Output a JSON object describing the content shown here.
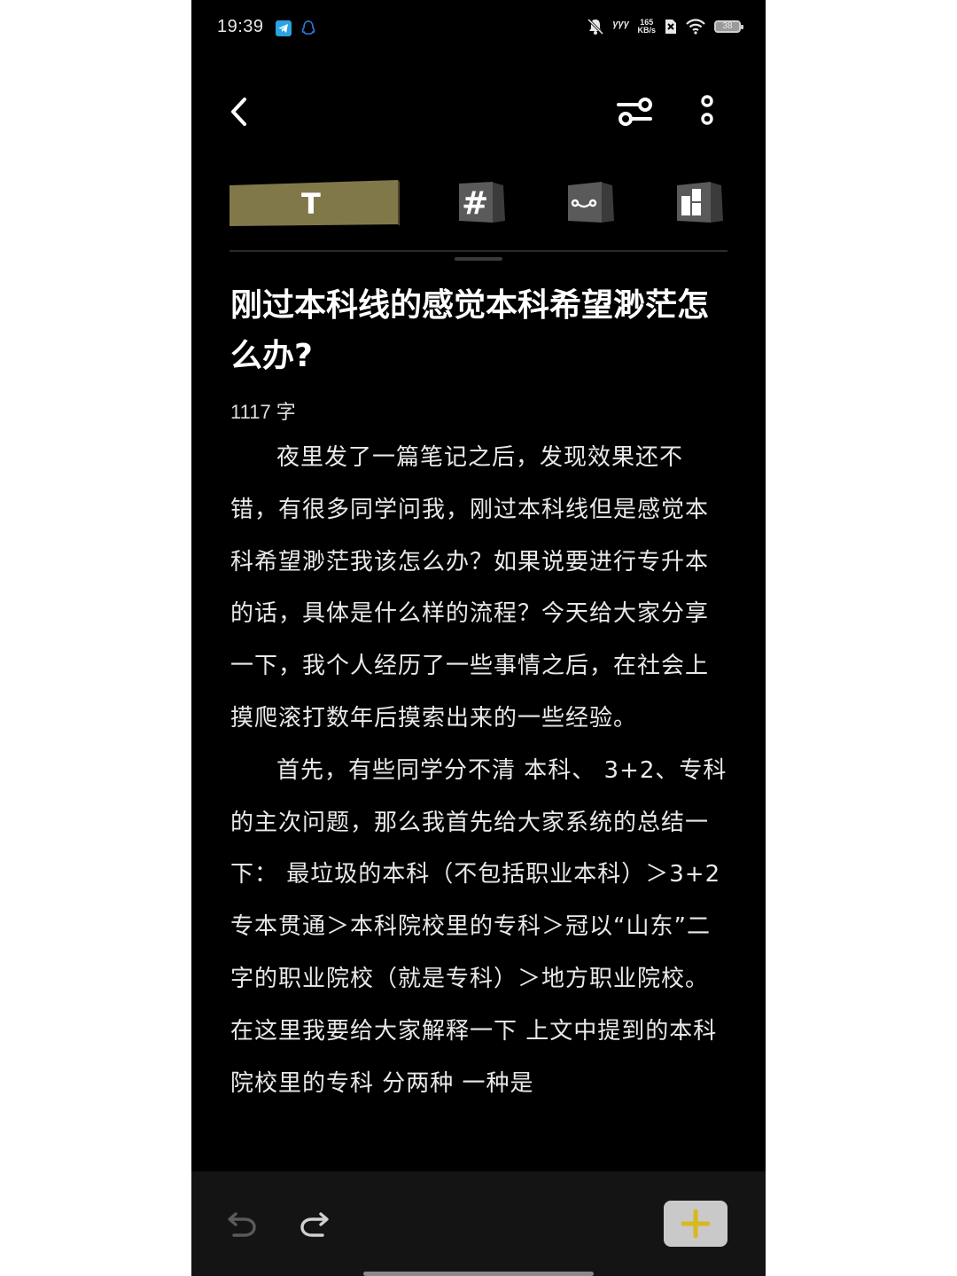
{
  "status_bar": {
    "time": "19:39",
    "network_speed_value": "165",
    "network_speed_unit": "KB/s",
    "signal_label": "ᵞᵞᵞ",
    "battery_level": "38"
  },
  "header": {
    "back_icon": "chevron-left-icon",
    "settings_icon": "sliders-icon",
    "more_icon": "more-vertical-icon"
  },
  "toolbar": {
    "tabs": [
      {
        "label": "T",
        "icon": "text-format-icon",
        "active": true
      },
      {
        "label": "#",
        "icon": "hashtag-icon",
        "active": false
      },
      {
        "label": "",
        "icon": "link-icon",
        "active": false
      },
      {
        "label": "",
        "icon": "layout-icon",
        "active": false
      }
    ],
    "active_color": "#817849"
  },
  "note": {
    "title": "刚过本科线的感觉本科希望渺茫怎么办?",
    "word_count": "1117 字",
    "paragraphs": [
      "夜里发了一篇笔记之后，发现效果还不错，有很多同学问我，刚过本科线但是感觉本科希望渺茫我该怎么办？如果说要进行专升本的话，具体是什么样的流程？今天给大家分享一下，我个人经历了一些事情之后，在社会上摸爬滚打数年后摸索出来的一些经验。",
      "首先，有些同学分不清 本科、 3+2、专科的主次问题，那么我首先给大家系统的总结一下： 最垃圾的本科（不包括职业本科）＞3+2专本贯通＞本科院校里的专科＞冠以“山东”二字的职业院校（就是专科）＞地方职业院校。在这里我要给大家解释一下 上文中提到的本科院校里的专科 分两种 一种是"
    ]
  },
  "bottom_bar": {
    "undo_icon": "undo-icon",
    "redo_icon": "redo-icon",
    "add_icon": "plus-icon",
    "add_button_color": "#c9c9c9",
    "add_icon_color": "#d9b81f"
  }
}
